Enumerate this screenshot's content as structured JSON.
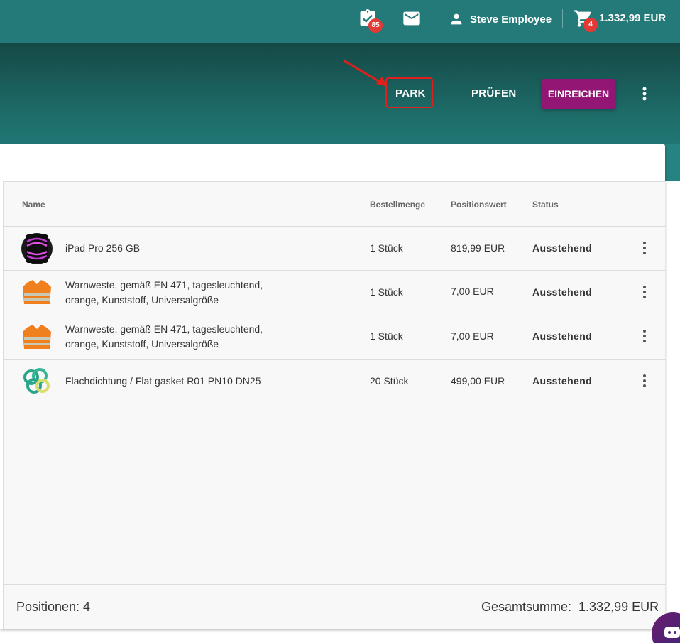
{
  "topbar": {
    "tasks_icon": "clipboard-check-icon",
    "tasks_count": "85",
    "mail_icon": "mail-icon",
    "user_icon": "person-icon",
    "user_name": "Steve Employee",
    "cart_icon": "cart-icon",
    "cart_count": "4",
    "cart_total": "1.332,99 EUR",
    "color": "#237a78"
  },
  "actions": {
    "park": "PARK",
    "pruefen": "PRÜFEN",
    "einreichen": "EINREICHEN",
    "more_icon": "more-vert-icon",
    "einreichen_color": "#931675",
    "highlight_color": "#e0201c"
  },
  "table": {
    "headers": [
      "Name",
      "Bestellmenge",
      "Positionswert",
      "Status"
    ],
    "rows": [
      {
        "name_line1": "iPad Pro 256 GB",
        "name_line2": "",
        "qty": "1 Stück",
        "value": "819,99 EUR",
        "status": "Ausstehend",
        "thumb": "ipad-image"
      },
      {
        "name_line1": "Warnweste, gemäß EN 471, tagesleuchtend,",
        "name_line2": "orange, Kunststoff, Universalgröße",
        "qty": "1 Stück",
        "value": "7,00 EUR",
        "status": "Ausstehend",
        "thumb": "vest-image"
      },
      {
        "name_line1": "Warnweste, gemäß EN 471, tagesleuchtend,",
        "name_line2": "orange, Kunststoff, Universalgröße",
        "qty": "1 Stück",
        "value": "7,00 EUR",
        "status": "Ausstehend",
        "thumb": "vest-image"
      },
      {
        "name_line1": "Flachdichtung / Flat gasket R01 PN10 DN25",
        "name_line2": "",
        "qty": "20 Stück",
        "value": "499,00 EUR",
        "status": "Ausstehend",
        "thumb": "gasket-image"
      }
    ]
  },
  "footer": {
    "positions": "Positionen: 4",
    "total": "Gesamtsumme:  1.332,99 EUR"
  }
}
